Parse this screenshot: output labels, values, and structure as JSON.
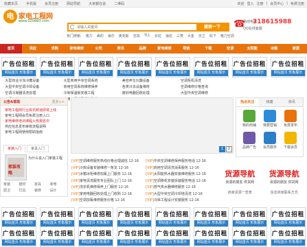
{
  "topbar": {
    "links": [
      "收藏本页",
      "手机版",
      "会员注册",
      "网站导航",
      "大家都在说",
      "二维码"
    ],
    "right": [
      "欢迎",
      "登入",
      "注册",
      "|",
      "会员中心",
      "|",
      "免费注册"
    ]
  },
  "logo": {
    "mark": "电",
    "name": "家电工程网",
    "url": "www.020883.com"
  },
  "search": {
    "placeholder": "请输入关键词",
    "button": "搜索一下"
  },
  "hot_words": [
    "热门搜索:",
    "格力",
    "美的",
    "海尔",
    "奥克斯",
    "志高",
    "TCL",
    "长虹",
    "海信",
    "三菱",
    "大金",
    "日立",
    "松下",
    "格力空调"
  ],
  "phone": {
    "label": "热线电话",
    "number": "318615988",
    "qq": "QQ在线客服"
  },
  "nav": [
    "首页",
    "供应",
    "求购",
    "家电维修",
    "公司",
    "资讯",
    "品牌",
    "家电维修",
    "导航",
    "下载",
    "空调",
    "太阳能",
    "冰箱",
    "家居"
  ],
  "ad": {
    "title": "广告位招租",
    "sub": "网站首页 形象展示"
  },
  "ad_rows_count": [
    8,
    8,
    8
  ],
  "link_items": [
    "大型商业冷冻冷藏设备",
    "大型商用中央空调系统",
    "美容养生仪器设备",
    "空调柜机清洗",
    "大型中央空调冷却设备",
    "商用空调系统维修保养",
    "各类冷冻设备维修",
    "空调维修价格查询",
    "空调冷凝器清洗处理",
    "冷库保温板安装工程",
    "废旧电器回收处理",
    "大型中央空调维修",
    "空调冷凝水管安装",
    "商用空调新风系统改造"
  ],
  "sidebar": {
    "title": "公告&帮助",
    "more": "更多>>",
    "items": [
      "家电工程网行业资讯频道即将上线",
      "家电工程网会员免费注册入口",
      "家电维修培训课程火热报名中",
      "供应信息发布审核流程说明",
      "家电工程网使用帮助指南"
    ],
    "item_colors": [
      "red",
      "normal",
      "red",
      "normal",
      "normal"
    ],
    "tabs": [
      "家装入门",
      "家具入门"
    ],
    "book_title": "家装攻略",
    "book_caption": "为什么说入门家装工程",
    "subs": [
      "家装",
      "建材",
      "家具",
      "家电",
      "厨卫",
      "灯具",
      "装修",
      "设计"
    ]
  },
  "hot_card": {
    "tabs": [
      "热点关注",
      "快捷",
      "资讯"
    ],
    "items": [
      {
        "label": "我的商铺",
        "color": "#59a83a"
      },
      {
        "label": "我要营销",
        "color": "#2f8bd8"
      },
      {
        "label": "免费发布",
        "color": "#e8720c"
      },
      {
        "label": "品牌广告",
        "color": "#6f5aa8"
      },
      {
        "label": "会员服务",
        "color": "#2c7fc6"
      },
      {
        "label": "下载会员",
        "color": "#f2b600"
      }
    ]
  },
  "banner": {
    "pager": [
      "1",
      "2"
    ]
  },
  "news": [
    {
      "tag": "[VIP]",
      "text": "空调维修服务热线价格合理诚信 12-16"
    },
    {
      "tag": "[VIP]",
      "text": "中央空调维修保养服务电话 12-16"
    },
    {
      "tag": "[VIP]",
      "text": "冷库设备安装维修一条龙 12-16"
    },
    {
      "tag": "[VIP]",
      "text": "商用空调清洗消毒服务 12-16"
    },
    {
      "tag": "[VIP]",
      "text": "冰箱冰柜维修加氟上门服务 12-16"
    },
    {
      "tag": "[VIP]",
      "text": "太阳能热水器安装维修服务 12-16"
    },
    {
      "tag": "[VIP]",
      "text": "家电清洗服务专业团队上门 12-16"
    },
    {
      "tag": "[VIP]",
      "text": "空调移机安装拆装服务电话 12-16"
    },
    {
      "tag": "[VIP]",
      "text": "洗衣机维修保养上门服务 12-16"
    },
    {
      "tag": "[VIP]",
      "text": "燃气热水器维修服务 12-16"
    },
    {
      "tag": "[VIP]",
      "text": "家用电器回收处理上门收购 12-16"
    },
    {
      "tag": "[VIP]",
      "text": "大型中央空调冷却塔清洗 12-16"
    },
    {
      "tag": "[VIP]",
      "text": "空调加氟维修服务价格 12-16"
    },
    {
      "tag": "[VIP]",
      "text": "冷库工程设计安装服务 12-16"
    }
  ],
  "nav_ads": [
    {
      "big": "货源导航",
      "sm": "资源的朋友 供货网",
      "cap": "商家货源一览表"
    },
    {
      "big": "货源导航",
      "sm": "资源的朋友 供货网",
      "cap": "信息商家联系方式"
    }
  ]
}
